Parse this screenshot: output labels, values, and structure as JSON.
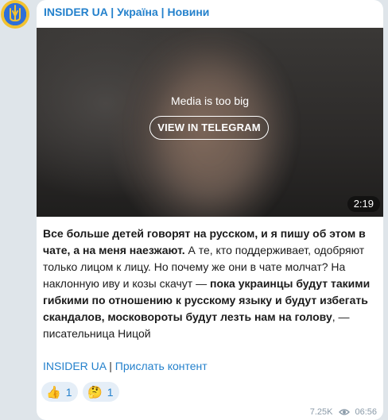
{
  "channel": {
    "name": "INSIDER UA | Україна | Новини",
    "avatar_icon": "trident-emblem-icon"
  },
  "media": {
    "notice": "Media is too big",
    "view_button_label": "VIEW IN TELEGRAM",
    "duration": "2:19"
  },
  "message": {
    "segments": [
      {
        "bold": true,
        "text": "Все больше детей говорят на русском, и я пишу об этом в чате, а на меня наезжают."
      },
      {
        "bold": false,
        "text": " А те, кто поддерживает, одобряют только лицом к лицу. Но почему же они в чате молчат? На наклонную иву и козы скачут — "
      },
      {
        "bold": true,
        "text": "пока украинцы будут такими гибкими по отношению к русскому языку и будут избегать скандалов, московороты будут лезть нам на голову"
      },
      {
        "bold": false,
        "text": ", — писательница Ницой"
      }
    ]
  },
  "links": {
    "channel_link": "INSIDER UA",
    "separator": "|",
    "submit_link": "Прислать контент"
  },
  "reactions": [
    {
      "emoji": "👍",
      "icon": "thumbs-up-icon",
      "count": "1"
    },
    {
      "emoji": "🤔",
      "icon": "thinking-face-icon",
      "count": "1"
    }
  ],
  "meta": {
    "views": "7.25K",
    "views_icon": "eye-icon",
    "time": "06:56"
  },
  "colors": {
    "accent": "#2481cc",
    "background": "#dfe5ea",
    "reaction_bg": "#e5eef7"
  }
}
